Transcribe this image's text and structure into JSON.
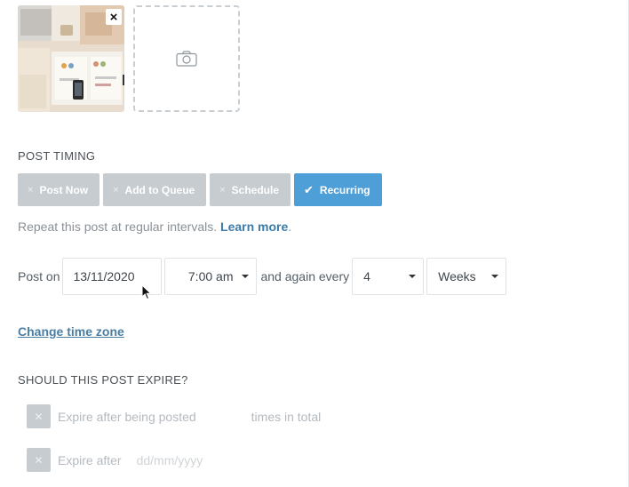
{
  "media": {
    "remove_label": "×"
  },
  "post_timing": {
    "title": "POST TIMING",
    "options": [
      {
        "label": "Post Now",
        "icon": "×",
        "active": false
      },
      {
        "label": "Add to Queue",
        "icon": "×",
        "active": false
      },
      {
        "label": "Schedule",
        "icon": "×",
        "active": false
      },
      {
        "label": "Recurring",
        "icon": "✔",
        "active": true
      }
    ],
    "helper_text": "Repeat this post at regular intervals. ",
    "learn_more": "Learn more",
    "helper_end": "."
  },
  "recurring": {
    "post_on_label": "Post on",
    "date_value": "13/11/2020",
    "time_value": "7:00 am",
    "again_label": "and again every",
    "interval_value": "4",
    "unit_value": "Weeks"
  },
  "change_timezone": "Change time zone",
  "expire": {
    "title": "SHOULD THIS POST EXPIRE?",
    "after_posted_label": "Expire after being posted",
    "times_label": "times in total",
    "after_date_label": "Expire after",
    "date_placeholder": "dd/mm/yyyy"
  },
  "colors": {
    "accent": "#4e9ed8",
    "inactive": "#c7ccd0",
    "link": "#3d7ba8"
  }
}
